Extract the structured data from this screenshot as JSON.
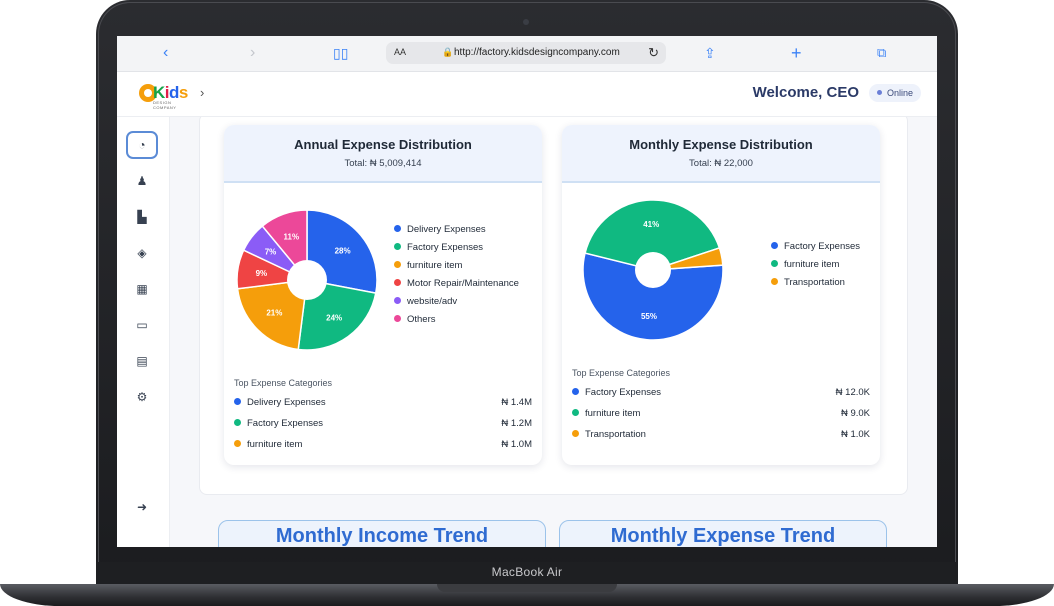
{
  "device": {
    "label": "MacBook Air"
  },
  "browser": {
    "text_size_label": "AA",
    "url": "http://factory.kidsdesigncompany.com",
    "icons": [
      "back-icon",
      "forward-icon",
      "bookmarks-icon",
      "reload-icon",
      "share-icon",
      "new-tab-icon",
      "tabs-icon"
    ]
  },
  "header": {
    "logo_text": [
      "K",
      "i",
      "d",
      "s"
    ],
    "logo_subtext": "DESIGN COMPANY",
    "welcome": "Welcome, CEO",
    "status": "Online"
  },
  "sidebar": {
    "items": [
      {
        "name": "dashboard",
        "icon": "speedometer-icon",
        "glyph": "◔"
      },
      {
        "name": "users",
        "icon": "users-icon",
        "glyph": "👤"
      },
      {
        "name": "factory",
        "icon": "factory-icon",
        "glyph": "▙"
      },
      {
        "name": "security",
        "icon": "shield-icon",
        "glyph": "◈"
      },
      {
        "name": "calculator",
        "icon": "calculator-icon",
        "glyph": "▦"
      },
      {
        "name": "store",
        "icon": "store-icon",
        "glyph": "▭"
      },
      {
        "name": "warehouse",
        "icon": "warehouse-icon",
        "glyph": "▤"
      },
      {
        "name": "settings",
        "icon": "gear-icon",
        "glyph": "⚙"
      },
      {
        "name": "logout",
        "icon": "logout-icon",
        "glyph": "➜"
      }
    ]
  },
  "annual": {
    "title": "Annual Expense Distribution",
    "total": "Total: ₦ 5,009,414",
    "top_title": "Top Expense Categories",
    "top": [
      {
        "label": "Delivery Expenses",
        "amount": "₦ 1.4M",
        "color": "#2563eb"
      },
      {
        "label": "Factory Expenses",
        "amount": "₦ 1.2M",
        "color": "#10b981"
      },
      {
        "label": "furniture item",
        "amount": "₦ 1.0M",
        "color": "#f59e0b"
      }
    ]
  },
  "monthly": {
    "title": "Monthly Expense Distribution",
    "total": "Total: ₦ 22,000",
    "top_title": "Top Expense Categories",
    "top": [
      {
        "label": "Factory Expenses",
        "amount": "₦ 12.0K",
        "color": "#2563eb"
      },
      {
        "label": "furniture item",
        "amount": "₦ 9.0K",
        "color": "#10b981"
      },
      {
        "label": "Transportation",
        "amount": "₦ 1.0K",
        "color": "#f59e0b"
      }
    ]
  },
  "trends": {
    "income": "Monthly Income Trend",
    "expense": "Monthly Expense Trend"
  },
  "chart_data": [
    {
      "type": "pie",
      "title": "Annual Expense Distribution",
      "categories": [
        "Delivery Expenses",
        "Factory Expenses",
        "furniture item",
        "Motor Repair/Maintenance",
        "website/adv",
        "Others"
      ],
      "values": [
        28,
        24,
        21,
        9,
        7,
        11
      ],
      "labels": [
        "28%",
        "24%",
        "21%",
        "9%",
        "7%",
        "11%"
      ],
      "colors": [
        "#2563eb",
        "#10b981",
        "#f59e0b",
        "#ef4444",
        "#8b5cf6",
        "#ec4899"
      ],
      "legend": "right"
    },
    {
      "type": "pie",
      "title": "Monthly Expense Distribution",
      "categories": [
        "Factory Expenses",
        "furniture item",
        "Transportation"
      ],
      "values": [
        55,
        41,
        4
      ],
      "labels": [
        "55%",
        "41%",
        ""
      ],
      "colors": [
        "#2563eb",
        "#10b981",
        "#f59e0b"
      ],
      "legend": "right"
    }
  ]
}
